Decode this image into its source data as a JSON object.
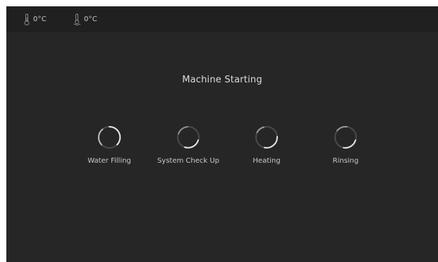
{
  "status_bar": {
    "temperatures": [
      {
        "icon": "boiler-thermometer-icon",
        "value": "0°C"
      },
      {
        "icon": "steam-thermometer-icon",
        "value": "0°C"
      }
    ]
  },
  "screen": {
    "title": "Machine Starting"
  },
  "steps": [
    {
      "label": "Water Filling",
      "icon": "loading-spinner-icon"
    },
    {
      "label": "System Check Up",
      "icon": "loading-spinner-icon"
    },
    {
      "label": "Heating",
      "icon": "loading-spinner-icon"
    },
    {
      "label": "Rinsing",
      "icon": "loading-spinner-icon"
    }
  ],
  "colors": {
    "background": "#262626",
    "status_bar": "#202020",
    "text": "#dcdcdc",
    "spinner_track": "#4a4a4a",
    "spinner_arc": "#e6e6e6"
  }
}
